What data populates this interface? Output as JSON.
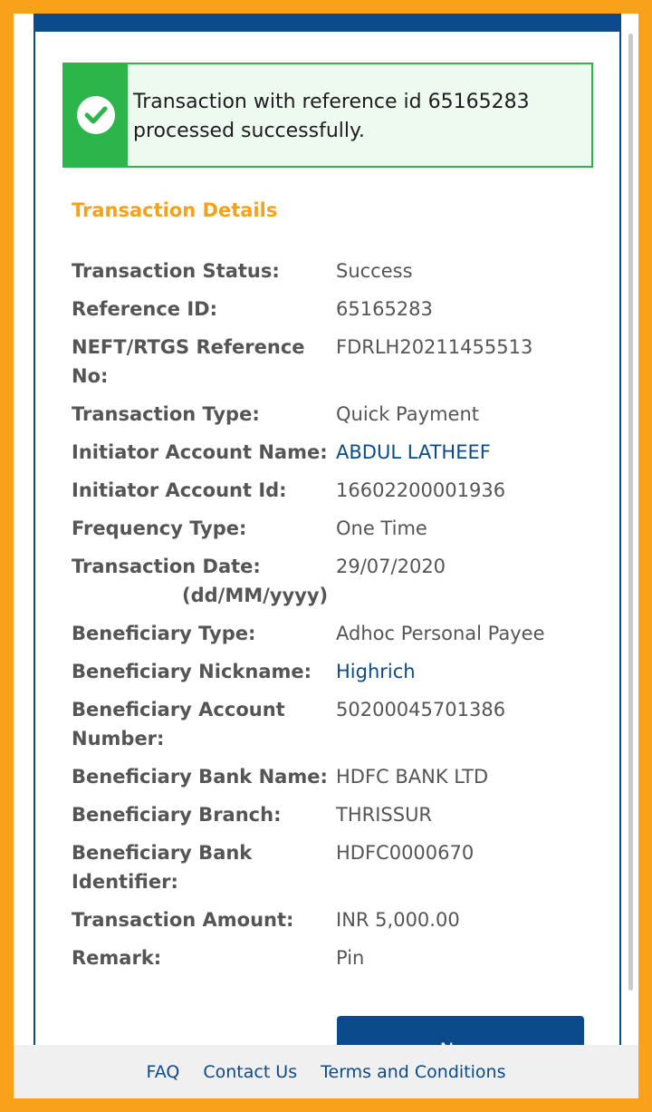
{
  "alert": {
    "message": "Transaction with reference id 65165283 processed successfully."
  },
  "section_title": "Transaction Details",
  "details": [
    {
      "label": "Transaction Status:",
      "value": "Success"
    },
    {
      "label": "Reference ID:",
      "value": "65165283"
    },
    {
      "label": "NEFT/RTGS Reference No:",
      "value": "FDRLH20211455513"
    },
    {
      "label": "Transaction Type:",
      "value": "Quick Payment"
    },
    {
      "label": "Initiator Account Name:",
      "value": "ABDUL LATHEEF"
    },
    {
      "label": "Initiator Account Id:",
      "value": "16602200001936"
    },
    {
      "label": "Frequency Type:",
      "value": "One Time"
    },
    {
      "label": "Transaction Date:",
      "label_sub": "(dd/MM/yyyy)",
      "value": "29/07/2020"
    },
    {
      "label": "Beneficiary Type:",
      "value": "Adhoc Personal Payee"
    },
    {
      "label": "Beneficiary Nickname:",
      "value": "Highrich"
    },
    {
      "label": "Beneficiary Account Number:",
      "value": "50200045701386"
    },
    {
      "label": "Beneficiary Bank Name:",
      "value": "HDFC BANK LTD"
    },
    {
      "label": "Beneficiary Branch:",
      "value": "THRISSUR"
    },
    {
      "label": "Beneficiary Bank Identifier:",
      "value": "HDFC0000670"
    },
    {
      "label": "Transaction Amount:",
      "value": "INR 5,000.00"
    },
    {
      "label": "Remark:",
      "value": "Pin"
    }
  ],
  "new_button_label": "New",
  "footer": {
    "faq": "FAQ",
    "contact": "Contact Us",
    "terms": "Terms and Conditions"
  },
  "colors": {
    "brand_blue": "#0b4a8b",
    "success_green": "#2bb54a",
    "accent_orange": "#f4a21a"
  }
}
